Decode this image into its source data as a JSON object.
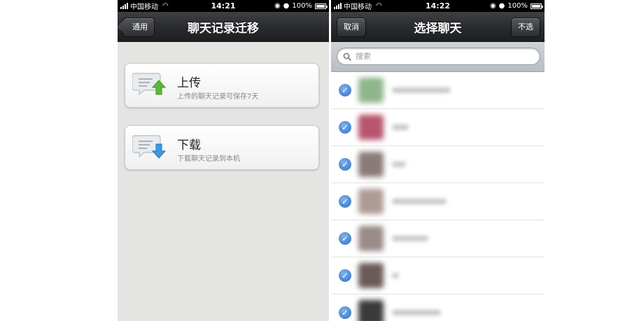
{
  "left_screen": {
    "status": {
      "carrier": "中国移动",
      "time": "14:21",
      "battery": "100%"
    },
    "nav": {
      "back_label": "通用",
      "title": "聊天记录迁移"
    },
    "cards": [
      {
        "title": "上传",
        "subtitle": "上传的聊天记录可保存7天",
        "arrow_color": "#5cb83a",
        "icon": "chat-upload-icon"
      },
      {
        "title": "下载",
        "subtitle": "下载聊天记录到本机",
        "arrow_color": "#3a9ae0",
        "icon": "chat-download-icon"
      }
    ]
  },
  "right_screen": {
    "status": {
      "carrier": "中国移动",
      "time": "14:22",
      "battery": "100%"
    },
    "nav": {
      "cancel_label": "取消",
      "title": "选择聊天",
      "deselect_label": "不选"
    },
    "search": {
      "placeholder": "搜索"
    },
    "contacts": [
      {
        "checked": true,
        "avatar_color": "#8fb58a"
      },
      {
        "checked": true,
        "avatar_color": "#b8546e"
      },
      {
        "checked": true,
        "avatar_color": "#8a7a78"
      },
      {
        "checked": true,
        "avatar_color": "#b09a94"
      },
      {
        "checked": true,
        "avatar_color": "#9a8a88"
      },
      {
        "checked": true,
        "avatar_color": "#6a5a58"
      },
      {
        "checked": true,
        "avatar_color": "#3a3a3a"
      }
    ]
  },
  "colors": {
    "navbar": "#2a2c2f",
    "accent_blue": "#2f6fc6",
    "left_bg": "#e4e4e2"
  }
}
